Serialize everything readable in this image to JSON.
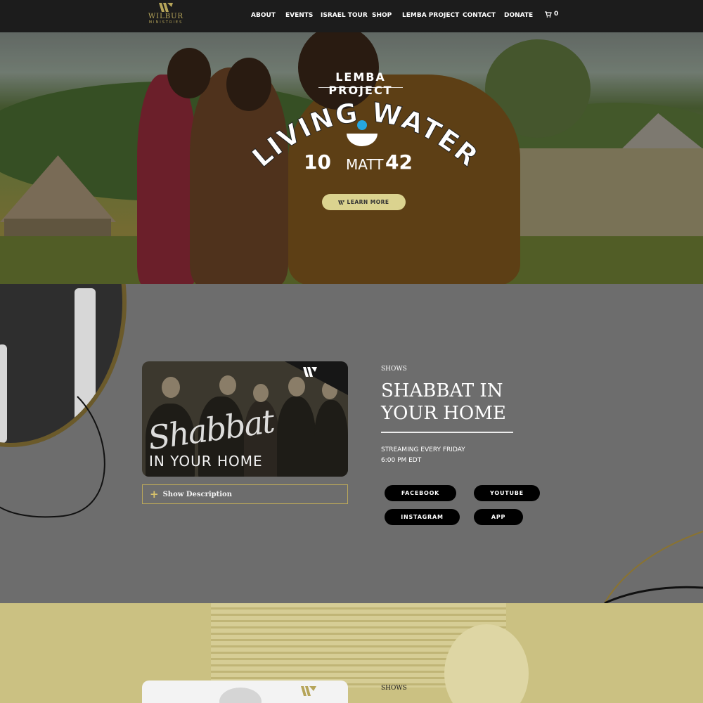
{
  "header": {
    "logo": {
      "name": "WILBUR",
      "tagline": "MINISTRIES"
    },
    "nav": [
      "ABOUT",
      "EVENTS",
      "ISRAEL TOUR",
      "SHOP",
      "LEMBA PROJECT",
      "CONTACT",
      "DONATE"
    ],
    "cart_count": "0"
  },
  "hero": {
    "title": "LEMBA PROJECT",
    "headline": "LIVING WATER",
    "verse": {
      "left": "10",
      "book": "MATT",
      "right": "42"
    },
    "button_label": "LEARN MORE"
  },
  "shows": {
    "thumbnail": {
      "script": "Shabbat",
      "subtitle": "IN YOUR HOME"
    },
    "description_toggle": "Show Description",
    "kicker": "SHOWS",
    "title": "SHABBAT IN YOUR HOME",
    "schedule": [
      "STREAMING EVERY FRIDAY",
      "6:00 PM EDT"
    ],
    "buttons": [
      "FACEBOOK",
      "YOUTUBE",
      "INSTAGRAM",
      "APP"
    ]
  },
  "next_section": {
    "kicker": "SHOWS"
  },
  "colors": {
    "header": "#1c1c1c",
    "gold": "#b6a55a",
    "hero_button": "#dbd38f",
    "section_grey": "#6d6d6d",
    "section_gold": "#cbc182"
  }
}
